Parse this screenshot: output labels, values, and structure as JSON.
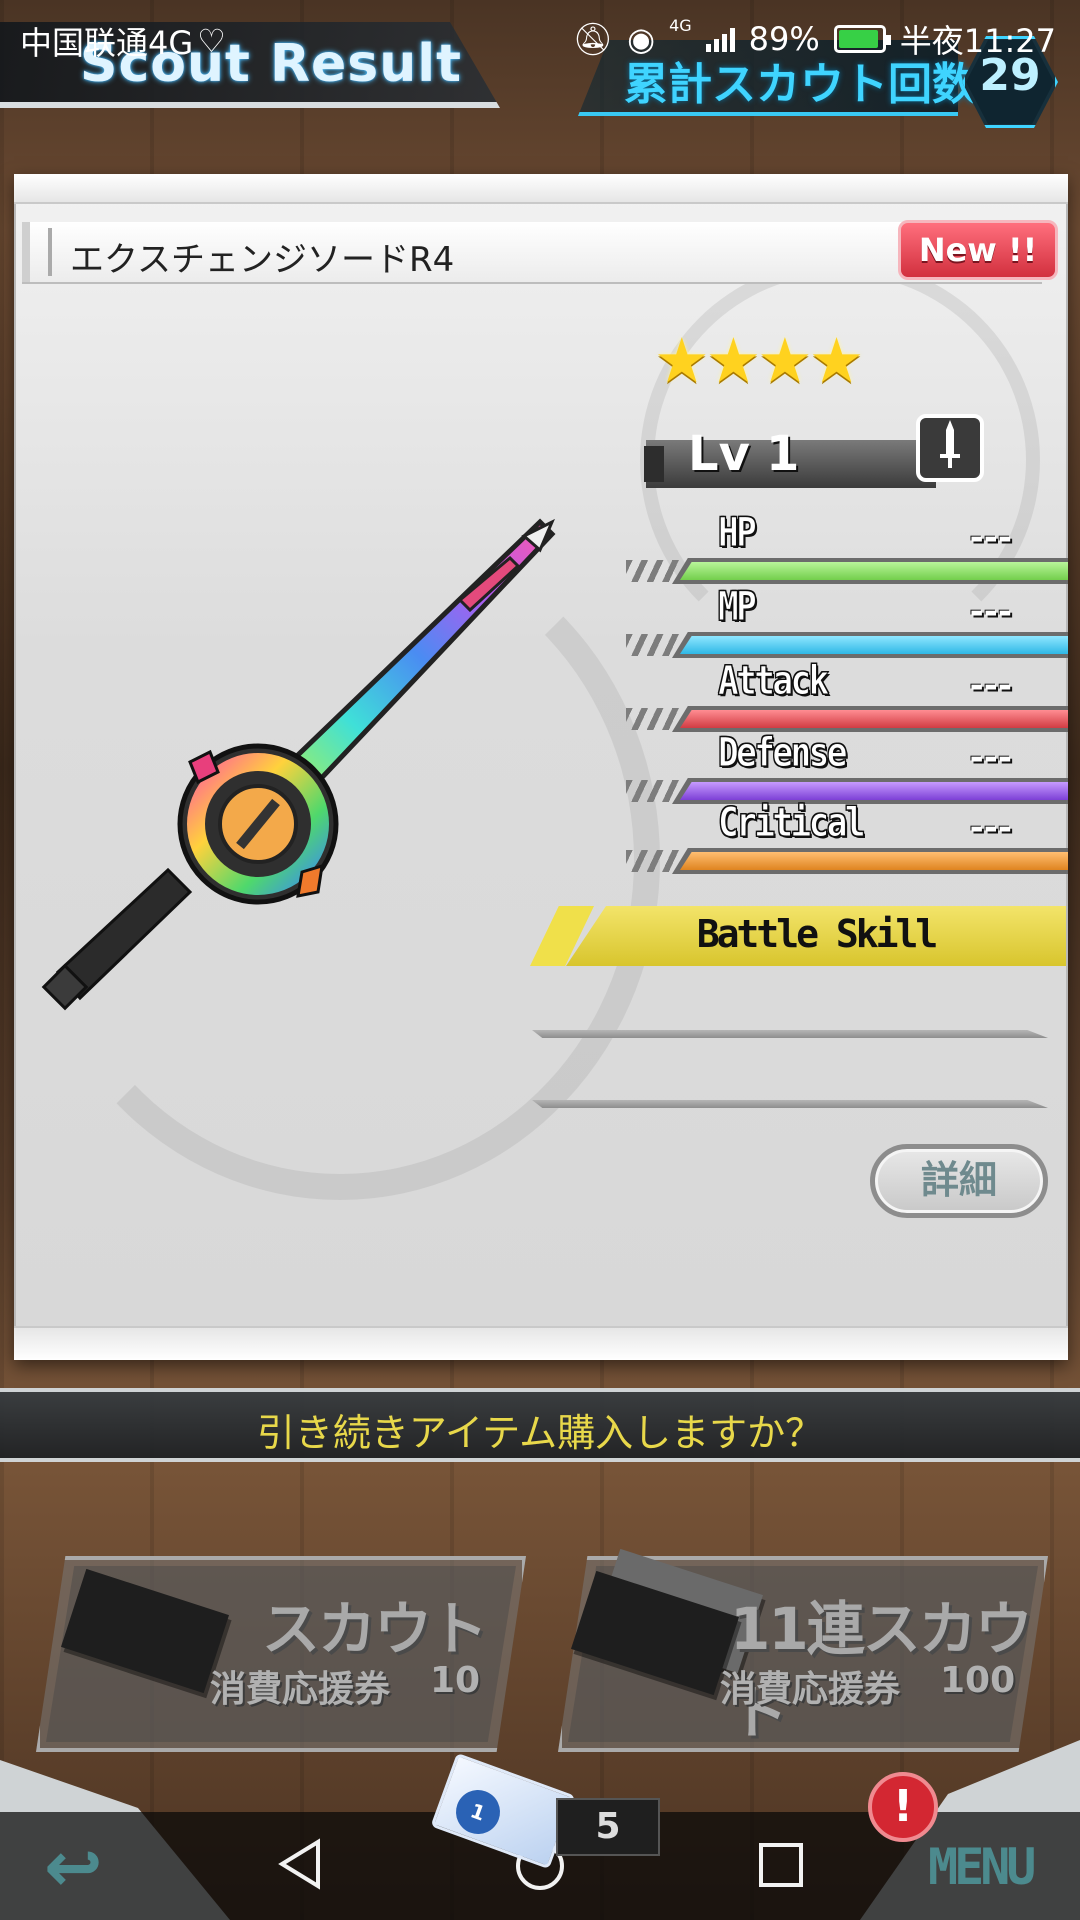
{
  "status_bar": {
    "carrier": "中国联通4G",
    "network": "4G",
    "battery": "89%",
    "time": "半夜11:27"
  },
  "header": {
    "title": "Scout Result",
    "count_label": "累計スカウト回数",
    "count_value": "29"
  },
  "item": {
    "name": "エクスチェンジソードR4",
    "new_badge": "New !!",
    "rarity_stars": 4,
    "stars_text": "★★★★",
    "level_label": "Lv",
    "level_value": "1",
    "weapon_type_icon": "sword-icon"
  },
  "stats": [
    {
      "label": "HP",
      "value": "---",
      "color": "#8fe06a"
    },
    {
      "label": "MP",
      "value": "---",
      "color": "#4dc9ee"
    },
    {
      "label": "Attack",
      "value": "---",
      "color": "#e0545a"
    },
    {
      "label": "Defense",
      "value": "---",
      "color": "#9a5fe0"
    },
    {
      "label": "Critical",
      "value": "---",
      "color": "#e8922e"
    }
  ],
  "skill": {
    "label": "Battle Skill"
  },
  "detail_button": "詳細",
  "prompt": "引き続きアイテム購入しますか？",
  "scout_single": {
    "title": "スカウト",
    "cost_label": "消費応援券",
    "cost_value": "10"
  },
  "scout_multi": {
    "title": "11連スカウト",
    "cost_label": "消費応援券",
    "cost_value": "100"
  },
  "tickets": {
    "count": "5"
  },
  "nav": {
    "menu": "MENU",
    "alert": "!"
  },
  "colors": {
    "accent_cyan": "#3fd4ff",
    "skill_yellow": "#e8d84a",
    "new_red": "#d2303e"
  }
}
